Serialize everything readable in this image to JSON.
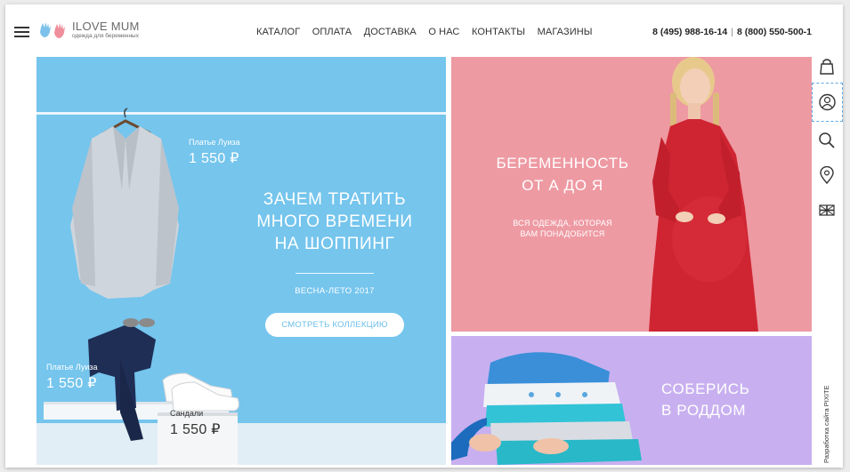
{
  "logo": {
    "title": "ILOVE MUM",
    "subtitle": "одежда для беременных"
  },
  "nav": {
    "items": [
      "КАТАЛОГ",
      "ОПЛАТА",
      "ДОСТАВКА",
      "О НАС",
      "КОНТАКТЫ",
      "МАГАЗИНЫ"
    ]
  },
  "phones": {
    "phone1": "8 (495) 988-16-14",
    "separator": "|",
    "phone2": "8 (800) 550-500-1"
  },
  "banner_main": {
    "title_lines": [
      "ЗАЧЕМ ТРАТИТЬ",
      "МНОГО ВРЕМЕНИ",
      "НА ШОППИНГ"
    ],
    "season": "ВЕСНА-ЛЕТО 2017",
    "cta": "СМОТРЕТЬ КОЛЛЕКЦИЮ",
    "tags": [
      {
        "name": "Платье Луиза",
        "price": "1 550 ₽"
      },
      {
        "name": "Платье Луиза",
        "price": "1 550 ₽"
      },
      {
        "name": "Сандали",
        "price": "1 550 ₽"
      }
    ]
  },
  "banner_pregnancy": {
    "title_lines": [
      "БЕРЕМЕННОСТЬ",
      "ОТ А ДО Я"
    ],
    "desc_lines": [
      "ВСЯ ОДЕЖДА, КОТОРАЯ",
      "ВАМ ПОНАДОБИТСЯ"
    ]
  },
  "banner_maternity": {
    "title_lines": [
      "СОБЕРИСЬ",
      "В РОДДОМ"
    ]
  },
  "sidebar": {
    "icons": [
      "bag-icon",
      "account-icon",
      "search-icon",
      "location-pin-icon",
      "flag-icon"
    ],
    "credits": "Разработка сайта PIXITE"
  },
  "colors": {
    "blue": "#75c5ed",
    "pink": "#ee9aa3",
    "purple": "#c8b0f0",
    "accent_dashed": "#5ea8e6"
  }
}
